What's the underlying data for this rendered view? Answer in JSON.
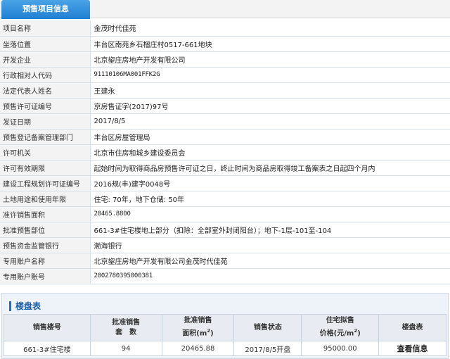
{
  "tab": {
    "label": "预售项目信息"
  },
  "info_rows": [
    {
      "label": "项目名称",
      "value": "金茂时代佳苑"
    },
    {
      "label": "坐落位置",
      "value": "丰台区南苑乡石榴庄村0517-661地块"
    },
    {
      "label": "开发企业",
      "value": "北京鋆庄房地产开发有限公司"
    },
    {
      "label": "行政相对人代码",
      "value": "91110106MA001FFK2G"
    },
    {
      "label": "法定代表人姓名",
      "value": "王建永"
    },
    {
      "label": "预售许可证编号",
      "value": "京房售证字(2017)97号"
    },
    {
      "label": "发证日期",
      "value": "2017/8/5"
    },
    {
      "label": "预售登记备案管理部门",
      "value": "丰台区房屋管理局"
    },
    {
      "label": "许可机关",
      "value": "北京市住房和城乡建设委员会"
    },
    {
      "label": "许可有效期限",
      "value": "起始时间为取得商品房预售许可证之日，终止时间为商品房取得竣工备案表之日起四个月内"
    },
    {
      "label": "建设工程规划许可证编号",
      "value": "2016规(丰)建字0048号"
    },
    {
      "label": "土地用途和使用年限",
      "value": "住宅: 70年，地下仓储: 50年"
    },
    {
      "label": "准许销售面积",
      "value": "20465.8800"
    },
    {
      "label": "批准预售部位",
      "value": "661-3#住宅楼地上部分（扣除：全部室外封闭阳台）；地下-1层-101至-104"
    },
    {
      "label": "预售资金监管银行",
      "value": "渤海银行"
    },
    {
      "label": "专用账户名称",
      "value": "北京鋆庄房地产开发有限公司金茂时代佳苑"
    },
    {
      "label": "专用账户账号",
      "value": "2002780395000381"
    }
  ],
  "building_table": {
    "title": "楼盘表",
    "headers": {
      "building_no": "销售楼号",
      "approved_sets_1": "批准销售",
      "approved_sets_2": "套　数",
      "approved_area_1": "批准销售",
      "approved_area_2": "面积(m",
      "approved_area_sup": "2",
      "approved_area_3": ")",
      "status": "销售状态",
      "price_1": "住宅拟售",
      "price_2": "价格(元/m",
      "price_sup": "2",
      "price_3": ")",
      "table_link": "楼盘表"
    },
    "rows": [
      {
        "building_no": "661-3#住宅楼",
        "sets": "94",
        "area": "20465.88",
        "status": "2017/8/5开盘",
        "price": "95000.00",
        "link": "查看信息"
      }
    ]
  }
}
